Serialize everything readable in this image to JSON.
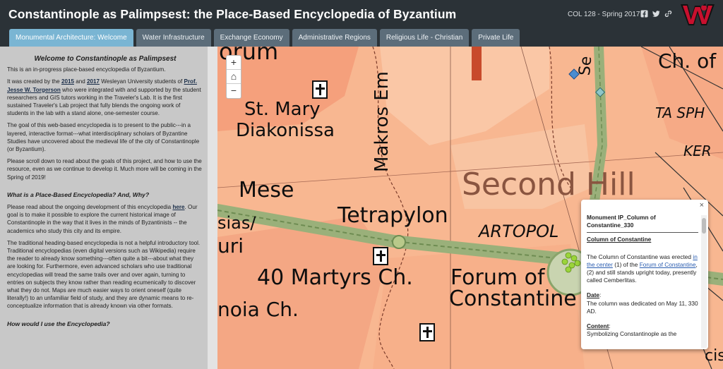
{
  "header": {
    "title": "Constantinople as Palimpsest: the Place-Based Encyclopedia of Byzantium",
    "course": "COL 128 - Spring 2017",
    "social_icons": [
      "facebook-icon",
      "twitter-icon",
      "link-icon"
    ],
    "logo": "W",
    "logo_color": "#c8102e"
  },
  "tabs": [
    {
      "label": "Monumental Architecture: Welcome",
      "active": true
    },
    {
      "label": "Water Infrastructure",
      "active": false
    },
    {
      "label": "Exchange Economy",
      "active": false
    },
    {
      "label": "Administrative Regions",
      "active": false
    },
    {
      "label": "Religious Life - Christian",
      "active": false
    },
    {
      "label": "Private Life",
      "active": false
    }
  ],
  "sidebar": {
    "heading": "Welcome to Constantinople as Palimpsest",
    "intro": "This is an in-progress place-based encyclopedia of Byzantium.",
    "p2_a": "It was created by the ",
    "link_2015": "2015",
    "p2_b": " and ",
    "link_2017": "2017",
    "p2_c": " Wesleyan University students of ",
    "link_prof": "Prof. Jesse W. Torgerson",
    "p2_d": " who were integrated with and supported by the student researchers and GIS tutors working in the Traveler's Lab. It is the first sustained Traveler's Lab project that fully blends the ongoing work of students in the lab with a stand alone, one-semester course.",
    "p3": "The goal of this web-based encyclopedia is to present to the public---in a layered, interactive format---what interdisciplinary scholars of Byzantine Studies have uncovered about the medieval life of the city of Constantinople (or Byzantium).",
    "p4": "Please scroll down to read about the goals of this project, and how to use the resource, even as we continue to develop it. Much more will be coming in the Spring of 2019!",
    "h_what": "What is a Place-Based Encyclopedia? And, Why?",
    "p5_a": "Please read about the ongoing development of this encyclopedia ",
    "link_here": "here",
    "p5_b": ". Our goal is to make it possible to explore the current historical image of Constantinople in the way that it lives in the minds of Byzantinists -- the academics who study this city and its empire.",
    "p6": "The traditional heading-based encyclopedia is not a helpful introductory tool. Traditional encyclopedias (even digital versions such as Wikipedia) require the reader to already know something---often quite a bit---about what they are looking for. Furthermore, even advanced scholars who use traditional encyclopedias will tread the same trails over and over again, turning to entries on subjects they know rather than reading ecumenically to discover what they do not. Maps are much easier ways to orient oneself (quite literally!) to an unfamiliar field of study, and they are dynamic means to re-conceptualize information that is already known via other formats.",
    "h_how": "How would I use the Encyclopedia?"
  },
  "map": {
    "zoom_in": "+",
    "home": "⌂",
    "zoom_out": "−",
    "labels": {
      "forum_top": "orum",
      "stmary1": "St. Mary",
      "stmary2": "Diakonissa",
      "makros": "Makros Em",
      "se": "Se",
      "chof": "Ch. of",
      "tasph": "TA SPH",
      "ker": "KER",
      "second": "Second Hill",
      "mese": "Mese",
      "sias": "sias/",
      "uri": "uri",
      "tetra": "Tetrapylon",
      "artopo": "ARTOPOL",
      "martyrs": "40 Martyrs Ch.",
      "forum1": "Forum of",
      "forum2": "Constantine",
      "noia": "noia Ch.",
      "cist": "cist"
    }
  },
  "popup": {
    "close": "×",
    "title": "Monument IP_Column of Constantine_330",
    "subtitle": "Column of Constantine",
    "desc_a": "The Column of Constantine was erected ",
    "link_center": "in the center",
    "desc_b": " (1) of the ",
    "link_forum": "Forum of Constantine",
    "desc_c": ",(2) and still stands upright today, presently called Cemberlitas.",
    "date_label": "Date",
    "date_text": "The column was dedicated on May 11, 330 AD.",
    "content_label": "Content",
    "content_text": "Symbolizing Constantinople as the"
  }
}
